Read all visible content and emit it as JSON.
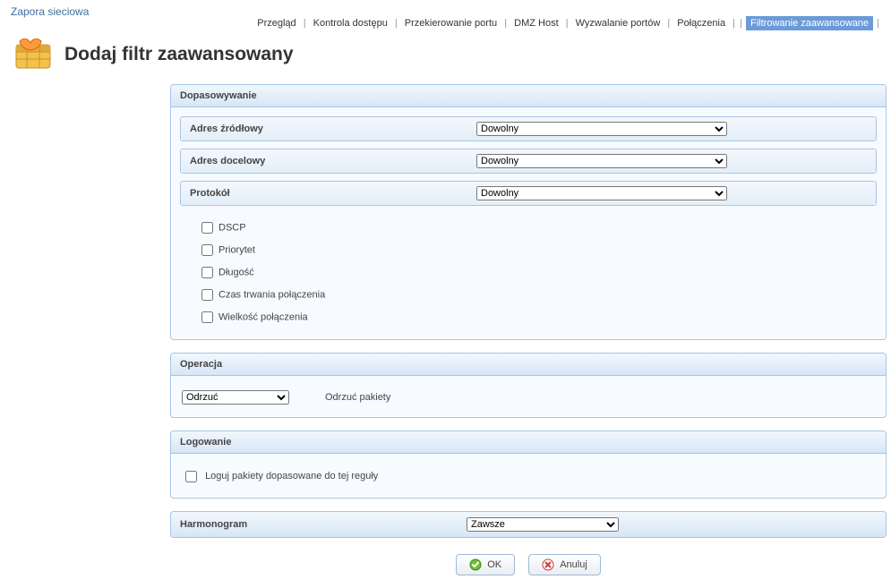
{
  "breadcrumb": {
    "label": "Zapora sieciowa"
  },
  "nav": {
    "items": [
      {
        "label": "Przegląd",
        "active": false
      },
      {
        "label": "Kontrola dostępu",
        "active": false
      },
      {
        "label": "Przekierowanie portu",
        "active": false
      },
      {
        "label": "DMZ Host",
        "active": false
      },
      {
        "label": "Wyzwalanie portów",
        "active": false
      },
      {
        "label": "Połączenia",
        "active": false
      },
      {
        "label": "Filtrowanie zaawansowane",
        "active": true
      }
    ],
    "sep": "|"
  },
  "title": "Dodaj filtr zaawansowany",
  "match": {
    "header": "Dopasowywanie",
    "source": {
      "label": "Adres źródłowy",
      "value": "Dowolny",
      "options": [
        "Dowolny"
      ]
    },
    "dest": {
      "label": "Adres docelowy",
      "value": "Dowolny",
      "options": [
        "Dowolny"
      ]
    },
    "proto": {
      "label": "Protokół",
      "value": "Dowolny",
      "options": [
        "Dowolny"
      ]
    },
    "checks": [
      {
        "label": "DSCP",
        "checked": false
      },
      {
        "label": "Priorytet",
        "checked": false
      },
      {
        "label": "Długość",
        "checked": false
      },
      {
        "label": "Czas trwania połączenia",
        "checked": false
      },
      {
        "label": "Wielkość połączenia",
        "checked": false
      }
    ]
  },
  "operation": {
    "header": "Operacja",
    "value": "Odrzuć",
    "options": [
      "Odrzuć"
    ],
    "desc": "Odrzuć pakiety"
  },
  "logging": {
    "header": "Logowanie",
    "label": "Loguj pakiety dopasowane do tej reguły",
    "checked": false
  },
  "schedule": {
    "header": "Harmonogram",
    "value": "Zawsze",
    "options": [
      "Zawsze"
    ]
  },
  "buttons": {
    "ok": "OK",
    "cancel": "Anuluj"
  }
}
